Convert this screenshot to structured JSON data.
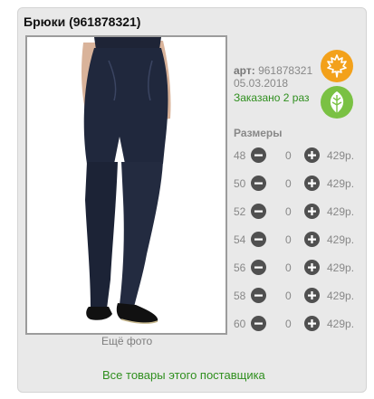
{
  "product": {
    "title": "Брюки (961878321)",
    "sku_label": "арт:",
    "sku_value": "961878321",
    "date": "05.03.2018",
    "ordered": "Заказано 2 раз",
    "more_photo": "Ещё фото"
  },
  "badges": [
    {
      "icon": "maple-leaf-icon",
      "color": "#f3a11b"
    },
    {
      "icon": "leaf-icon",
      "color": "#7ac143"
    }
  ],
  "sizes": {
    "heading": "Размеры",
    "rows": [
      {
        "size": "48",
        "qty": "0",
        "price": "429р."
      },
      {
        "size": "50",
        "qty": "0",
        "price": "429р."
      },
      {
        "size": "52",
        "qty": "0",
        "price": "429р."
      },
      {
        "size": "54",
        "qty": "0",
        "price": "429р."
      },
      {
        "size": "56",
        "qty": "0",
        "price": "429р."
      },
      {
        "size": "58",
        "qty": "0",
        "price": "429р."
      },
      {
        "size": "60",
        "qty": "0",
        "price": "429р."
      }
    ]
  },
  "footer": {
    "supplier_link": "Все товары этого поставщика"
  },
  "colors": {
    "accent_green": "#2f8f1e",
    "card_bg": "#e9e9e9"
  }
}
